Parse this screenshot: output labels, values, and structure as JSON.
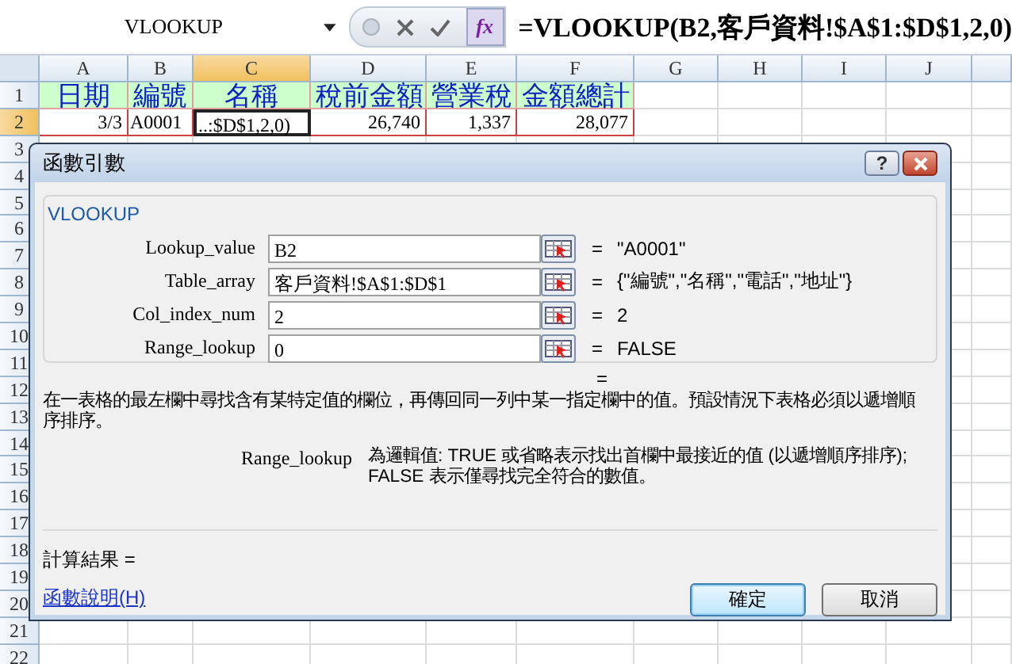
{
  "name_box": "VLOOKUP",
  "function_button": "fx",
  "formula": "=VLOOKUP(B2,客戶資料!$A$1:$D$1,2,0)",
  "columns": [
    {
      "label": "A",
      "selected": false
    },
    {
      "label": "B",
      "selected": false
    },
    {
      "label": "C",
      "selected": true
    },
    {
      "label": "D",
      "selected": false
    },
    {
      "label": "E",
      "selected": false
    },
    {
      "label": "F",
      "selected": false
    },
    {
      "label": "G",
      "selected": false
    },
    {
      "label": "H",
      "selected": false
    },
    {
      "label": "I",
      "selected": false
    },
    {
      "label": "J",
      "selected": false
    }
  ],
  "rows": [
    {
      "label": "1",
      "selected": false,
      "kind": "header",
      "cells": [
        {
          "text": "日期",
          "selected": false
        },
        {
          "text": "編號",
          "selected": false
        },
        {
          "text": "名稱",
          "selected": false
        },
        {
          "text": "稅前金額",
          "selected": false
        },
        {
          "text": "營業稅",
          "selected": false
        },
        {
          "text": "金額總計",
          "selected": false
        }
      ]
    },
    {
      "label": "2",
      "selected": true,
      "kind": "data",
      "cells": [
        {
          "text": "3/3",
          "selected": false
        },
        {
          "text": "A0001",
          "selected": false
        },
        {
          "text": "..:$D$1,2,0)",
          "selected": true
        },
        {
          "text": "26,740",
          "selected": false
        },
        {
          "text": "1,337",
          "selected": false
        },
        {
          "text": "28,077",
          "selected": false
        }
      ]
    },
    {
      "label": "3",
      "selected": false
    },
    {
      "label": "4",
      "selected": false
    },
    {
      "label": "5",
      "selected": false
    },
    {
      "label": "6",
      "selected": false
    },
    {
      "label": "7",
      "selected": false
    },
    {
      "label": "8",
      "selected": false
    },
    {
      "label": "9",
      "selected": false
    },
    {
      "label": "10",
      "selected": false
    },
    {
      "label": "11",
      "selected": false
    },
    {
      "label": "12",
      "selected": false
    },
    {
      "label": "13",
      "selected": false
    },
    {
      "label": "14",
      "selected": false
    },
    {
      "label": "15",
      "selected": false
    },
    {
      "label": "16",
      "selected": false
    },
    {
      "label": "17",
      "selected": false
    },
    {
      "label": "18",
      "selected": false
    },
    {
      "label": "19",
      "selected": false
    },
    {
      "label": "20",
      "selected": false
    },
    {
      "label": "21",
      "selected": false
    },
    {
      "label": "22",
      "selected": false
    }
  ],
  "dialog": {
    "title": "函數引數",
    "help_button": "?",
    "group": "VLOOKUP",
    "arguments": [
      {
        "name": "Lookup_value",
        "value": "B2",
        "equals": "=",
        "result": "\"A0001\""
      },
      {
        "name": "Table_array",
        "value": "客戶資料!$A$1:$D$1",
        "equals": "=",
        "result": "{\"編號\",\"名稱\",\"電話\",\"地址\"}"
      },
      {
        "name": "Col_index_num",
        "value": "2",
        "equals": "=",
        "result": "2"
      },
      {
        "name": "Range_lookup",
        "value": "0",
        "equals": "=",
        "result": "FALSE"
      }
    ],
    "total_equals": "=",
    "description": "在一表格的最左欄中尋找含有某特定值的欄位，再傳回同一列中某一指定欄中的值。預設情況下表格必須以遞增順序排序。",
    "help_argument": "Range_lookup",
    "help_text": "為邏輯值: TRUE 或省略表示找出首欄中最接近的值 (以遞增順序排序);\nFALSE 表示僅尋找完全符合的數值。",
    "result_label": "計算結果 =",
    "help_link": "函數說明(H)",
    "buttons": [
      {
        "label": "確定",
        "default": true
      },
      {
        "label": "取消",
        "default": false
      }
    ]
  }
}
